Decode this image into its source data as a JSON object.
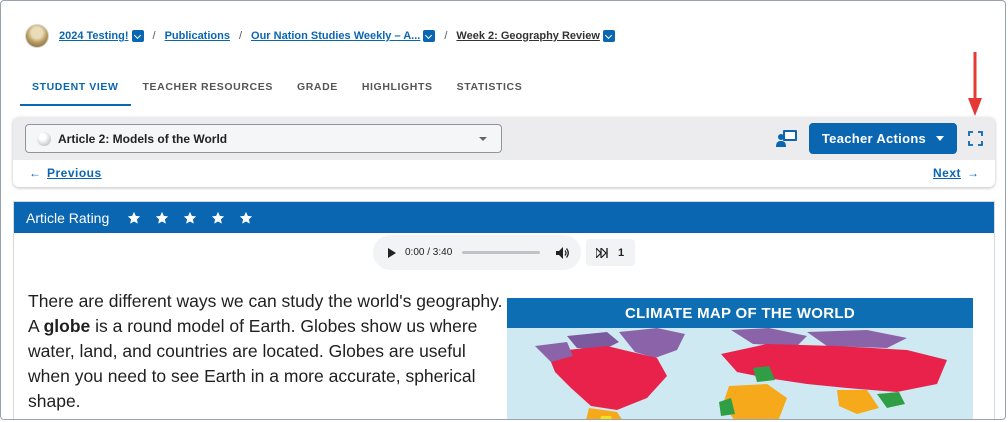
{
  "breadcrumb": {
    "items": [
      {
        "label": "2024 Testing!",
        "dropdown": true
      },
      {
        "label": "Publications",
        "dropdown": false
      },
      {
        "label": "Our Nation Studies Weekly – A...",
        "dropdown": true
      },
      {
        "label": "Week 2: Geography Review",
        "dropdown": true
      }
    ],
    "separator": "/"
  },
  "tabs": [
    {
      "label": "STUDENT VIEW",
      "active": true
    },
    {
      "label": "TEACHER RESOURCES",
      "active": false
    },
    {
      "label": "GRADE",
      "active": false
    },
    {
      "label": "HIGHLIGHTS",
      "active": false
    },
    {
      "label": "STATISTICS",
      "active": false
    }
  ],
  "toolbar": {
    "article_select_value": "Article 2: Models of the World",
    "teacher_actions_label": "Teacher Actions",
    "previous_label": "Previous",
    "next_label": "Next"
  },
  "article": {
    "rating_label": "Article Rating",
    "star_count": 5,
    "audio": {
      "time": "0:00 / 3:40",
      "progress": 0.0
    },
    "speed_value": "1",
    "text_before_bold": "There are different ways we can study the world's geography. A ",
    "text_bold": "globe",
    "text_after_bold": " is a round model of Earth. Globes show us where water, land, and countries are located. Globes are useful when you need to see Earth in a more accurate, spherical shape.",
    "map_title": "CLIMATE MAP OF THE WORLD"
  },
  "colors": {
    "brand_blue": "#0b66b2",
    "annotation_red": "#e53935"
  }
}
